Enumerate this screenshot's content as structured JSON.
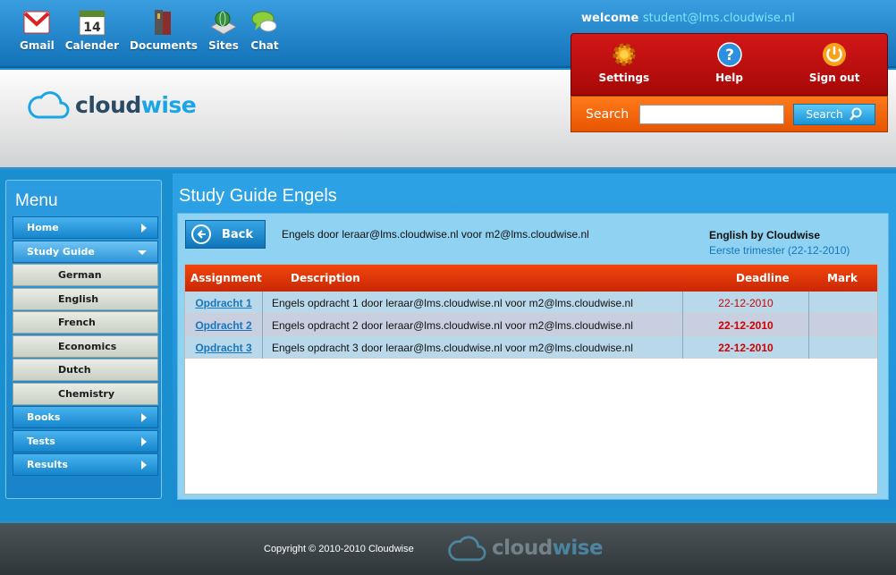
{
  "apps": [
    {
      "label": "Gmail",
      "icon": "gmail-icon"
    },
    {
      "label": "Calender",
      "icon": "calendar-icon",
      "day": "14"
    },
    {
      "label": "Documents",
      "icon": "documents-icon"
    },
    {
      "label": "Sites",
      "icon": "sites-icon"
    },
    {
      "label": "Chat",
      "icon": "chat-icon"
    }
  ],
  "welcome": {
    "prefix": "welcome",
    "user": "student@lms.cloudwise.nl"
  },
  "logo": {
    "part1": "cloud",
    "part2": "wise"
  },
  "userpanel": {
    "settings": "Settings",
    "help": "Help",
    "signout": "Sign out"
  },
  "search": {
    "label": "Search",
    "button": "Search",
    "value": ""
  },
  "menu": {
    "title": "Menu",
    "items": [
      {
        "label": "Home"
      },
      {
        "label": "Study Guide",
        "open": true
      },
      {
        "label": "Books"
      },
      {
        "label": "Tests"
      },
      {
        "label": "Results"
      }
    ],
    "subitems": [
      "German",
      "English",
      "French",
      "Economics",
      "Dutch",
      "Chemistry"
    ]
  },
  "main": {
    "title": "Study Guide Engels",
    "back": "Back",
    "course_desc": "Engels door leraar@lms.cloudwise.nl voor m2@lms.cloudwise.nl",
    "course_name": "English by Cloudwise",
    "course_term": "Eerste trimester (22-12-2010)"
  },
  "table": {
    "headers": {
      "assignment": "Assignment",
      "description": "Description",
      "deadline": "Deadline",
      "mark": "Mark"
    },
    "rows": [
      {
        "assignment": "Opdracht 1",
        "description": "Engels opdracht 1 door leraar@lms.cloudwise.nl voor m2@lms.cloudwise.nl",
        "deadline": "22-12-2010",
        "mark": ""
      },
      {
        "assignment": "Opdracht 2",
        "description": "Engels opdracht 2 door leraar@lms.cloudwise.nl voor m2@lms.cloudwise.nl",
        "deadline": "22-12-2010",
        "mark": ""
      },
      {
        "assignment": "Opdracht 3",
        "description": "Engels opdracht 3 door leraar@lms.cloudwise.nl voor m2@lms.cloudwise.nl",
        "deadline": "22-12-2010",
        "mark": ""
      }
    ]
  },
  "footer": {
    "copyright": "Copyright © 2010-2010 Cloudwise"
  }
}
